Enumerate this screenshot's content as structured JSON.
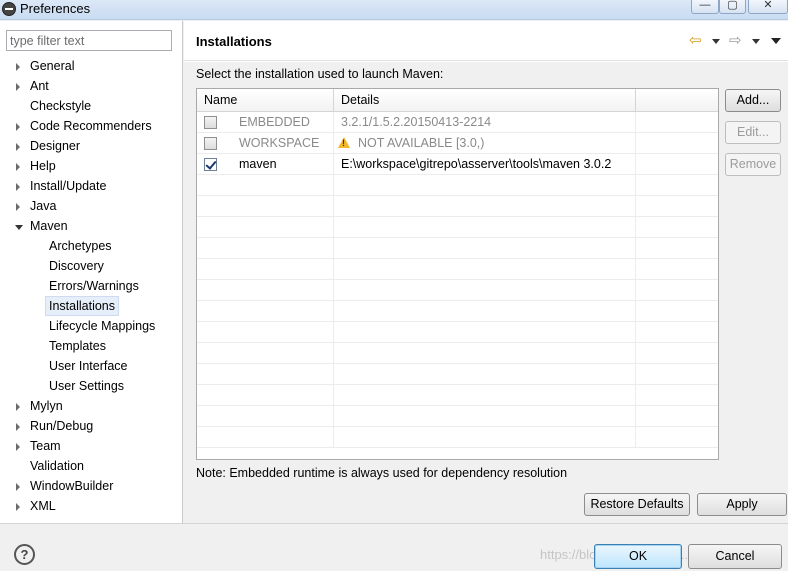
{
  "window": {
    "title": "Preferences",
    "min": "—",
    "max": "▢",
    "close": "✕"
  },
  "sidebar": {
    "filter_placeholder": "type filter text",
    "items": [
      {
        "label": "General",
        "expandable": true
      },
      {
        "label": "Ant",
        "expandable": true
      },
      {
        "label": "Checkstyle",
        "expandable": false
      },
      {
        "label": "Code Recommenders",
        "expandable": true
      },
      {
        "label": "Designer",
        "expandable": true
      },
      {
        "label": "Help",
        "expandable": true
      },
      {
        "label": "Install/Update",
        "expandable": true
      },
      {
        "label": "Java",
        "expandable": true
      },
      {
        "label": "Maven",
        "expandable": true,
        "expanded": true
      },
      {
        "label": "Archetypes",
        "child": true
      },
      {
        "label": "Discovery",
        "child": true
      },
      {
        "label": "Errors/Warnings",
        "child": true
      },
      {
        "label": "Installations",
        "child": true,
        "selected": true
      },
      {
        "label": "Lifecycle Mappings",
        "child": true
      },
      {
        "label": "Templates",
        "child": true
      },
      {
        "label": "User Interface",
        "child": true
      },
      {
        "label": "User Settings",
        "child": true
      },
      {
        "label": "Mylyn",
        "expandable": true
      },
      {
        "label": "Run/Debug",
        "expandable": true
      },
      {
        "label": "Team",
        "expandable": true
      },
      {
        "label": "Validation",
        "expandable": false
      },
      {
        "label": "WindowBuilder",
        "expandable": true
      },
      {
        "label": "XML",
        "expandable": true
      }
    ]
  },
  "page": {
    "title": "Installations",
    "instruction": "Select the installation used to launch Maven:",
    "table": {
      "columns": [
        "Name",
        "Details",
        ""
      ],
      "rows": [
        {
          "checked": false,
          "name": "EMBEDDED",
          "details": "3.2.1/1.5.2.20150413-2214",
          "disabled": true,
          "warning": false
        },
        {
          "checked": false,
          "name": "WORKSPACE",
          "details": "NOT AVAILABLE [3.0,)",
          "disabled": true,
          "warning": true
        },
        {
          "checked": true,
          "name": "maven",
          "details": "E:\\workspace\\gitrepo\\asserver\\tools\\maven 3.0.2",
          "disabled": false,
          "warning": false
        }
      ]
    },
    "buttons": {
      "add": "Add...",
      "edit": "Edit...",
      "remove": "Remove"
    },
    "note": "Note: Embedded runtime is always used for dependency resolution",
    "restore_defaults": "Restore Defaults",
    "apply": "Apply"
  },
  "footer": {
    "help": "?",
    "watermark": "https://blog.csdn.net/shu...457",
    "ok": "OK",
    "cancel": "Cancel"
  },
  "icons": {
    "back": "⇦",
    "forward": "⇨"
  }
}
